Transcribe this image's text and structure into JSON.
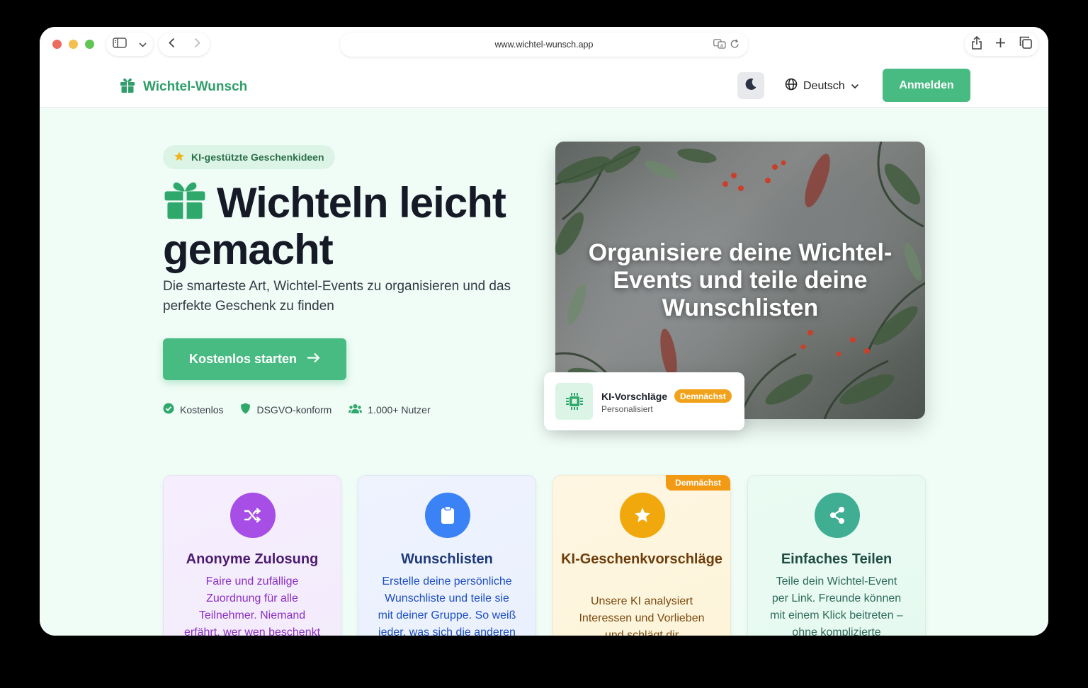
{
  "browser": {
    "url": "www.wichtel-wunsch.app"
  },
  "header": {
    "brand": "Wichtel-Wunsch",
    "language": "Deutsch",
    "login_label": "Anmelden"
  },
  "hero": {
    "badge": "KI-gestützte Geschenkideen",
    "headline_line1": "Wichteln leicht",
    "headline_line2": "gemacht",
    "subline": "Die smarteste Art, Wichtel-Events zu organisieren und das perfekte Geschenk zu finden",
    "cta_label": "Kostenlos starten",
    "trust": [
      {
        "label": "Kostenlos",
        "icon": "check-circle-icon"
      },
      {
        "label": "DSGVO-konform",
        "icon": "shield-icon"
      },
      {
        "label": "1.000+ Nutzer",
        "icon": "users-icon"
      }
    ],
    "image_caption": "Organisiere deine Wichtel-Events und teile deine Wunschlisten",
    "ki_card": {
      "title": "KI-Vorschläge",
      "badge": "Demnächst",
      "subtitle": "Personalisiert"
    }
  },
  "features": [
    {
      "title": "Anonyme Zulosung",
      "description": "Faire und zufällige Zuordnung für alle Teilnehmer. Niemand erfährt, wer wen beschenkt",
      "icon": "shuffle-icon"
    },
    {
      "title": "Wunschlisten",
      "description": "Erstelle deine persönliche Wunschliste und teile sie mit deiner Gruppe. So weiß jeder, was sich die anderen",
      "icon": "clipboard-icon"
    },
    {
      "title": "KI-Geschenkvorschläge",
      "badge": "Demnächst",
      "description": "Unsere KI analysiert Interessen und Vorlieben und schlägt dir",
      "icon": "star-icon"
    },
    {
      "title": "Einfaches Teilen",
      "description": "Teile dein Wichtel-Event per Link. Freunde können mit einem Klick beitreten – ohne komplizierte Registrierung.",
      "icon": "share-icon"
    }
  ],
  "colors": {
    "brand_green": "#48bb82",
    "background_mint": "#f0fcf6",
    "badge_orange": "#f1a21b"
  }
}
